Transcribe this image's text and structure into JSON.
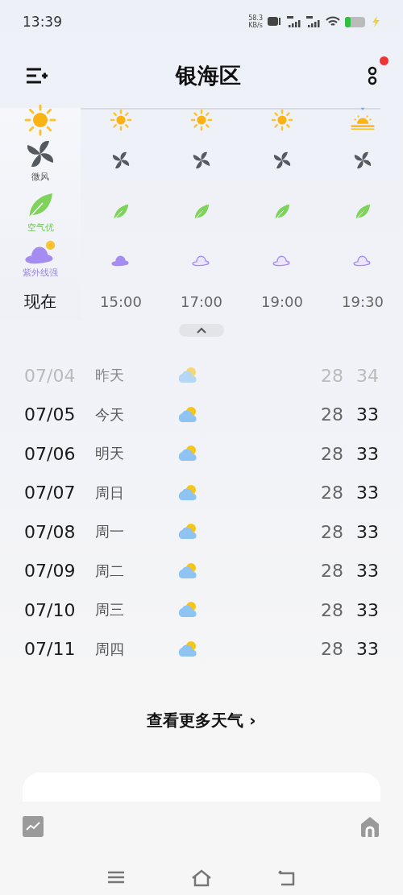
{
  "status_bar": {
    "time": "13:39",
    "net_speed": "58.3",
    "net_unit": "KB/s"
  },
  "header": {
    "title": "银海区",
    "menu_badge": true
  },
  "hourly": [
    {
      "time": "现在",
      "selected": true,
      "kind": "sun",
      "wind": "微风",
      "air": "空气优",
      "uv": "紫外线强",
      "uv_strong": true
    },
    {
      "time": "15:00",
      "selected": false,
      "kind": "sun",
      "uv_strong": true
    },
    {
      "time": "17:00",
      "selected": false,
      "kind": "sun",
      "uv_strong": false
    },
    {
      "time": "19:00",
      "selected": false,
      "kind": "sun",
      "uv_strong": false
    },
    {
      "time": "19:30",
      "selected": false,
      "kind": "sunset",
      "uv_strong": false
    }
  ],
  "daily": [
    {
      "date": "07/04",
      "day": "昨天",
      "low": "28",
      "high": "34",
      "past": true
    },
    {
      "date": "07/05",
      "day": "今天",
      "low": "28",
      "high": "33",
      "past": false
    },
    {
      "date": "07/06",
      "day": "明天",
      "low": "28",
      "high": "33",
      "past": false
    },
    {
      "date": "07/07",
      "day": "周日",
      "low": "28",
      "high": "33",
      "past": false
    },
    {
      "date": "07/08",
      "day": "周一",
      "low": "28",
      "high": "33",
      "past": false
    },
    {
      "date": "07/09",
      "day": "周二",
      "low": "28",
      "high": "33",
      "past": false
    },
    {
      "date": "07/10",
      "day": "周三",
      "low": "28",
      "high": "33",
      "past": false
    },
    {
      "date": "07/11",
      "day": "周四",
      "low": "28",
      "high": "33",
      "past": false
    }
  ],
  "more_link": {
    "label": "查看更多天气",
    "chevron": "›"
  }
}
